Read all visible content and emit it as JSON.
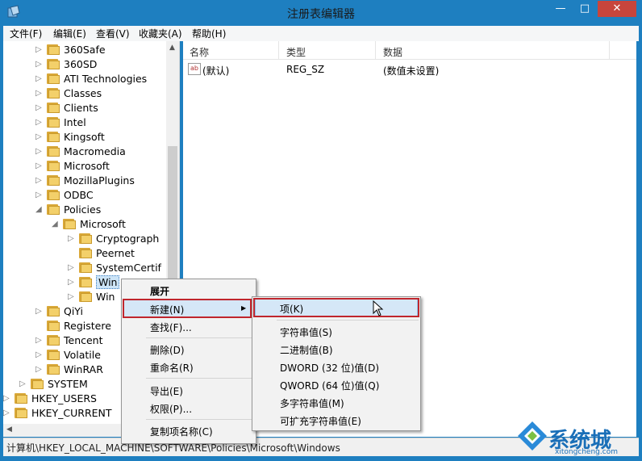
{
  "window": {
    "title": "注册表编辑器",
    "min_glyph": "—",
    "max_glyph": "□",
    "close_glyph": "✕"
  },
  "menubar": [
    "文件(F)",
    "编辑(E)",
    "查看(V)",
    "收藏夹(A)",
    "帮助(H)"
  ],
  "tree": [
    {
      "label": "360Safe",
      "level": 3,
      "expander": "▷"
    },
    {
      "label": "360SD",
      "level": 3,
      "expander": "▷"
    },
    {
      "label": "ATI Technologies",
      "level": 3,
      "expander": "▷"
    },
    {
      "label": "Classes",
      "level": 3,
      "expander": "▷"
    },
    {
      "label": "Clients",
      "level": 3,
      "expander": "▷"
    },
    {
      "label": "Intel",
      "level": 3,
      "expander": "▷"
    },
    {
      "label": "Kingsoft",
      "level": 3,
      "expander": "▷"
    },
    {
      "label": "Macromedia",
      "level": 3,
      "expander": "▷"
    },
    {
      "label": "Microsoft",
      "level": 3,
      "expander": "▷"
    },
    {
      "label": "MozillaPlugins",
      "level": 3,
      "expander": "▷"
    },
    {
      "label": "ODBC",
      "level": 3,
      "expander": "▷"
    },
    {
      "label": "Policies",
      "level": 3,
      "expander": "◢"
    },
    {
      "label": "Microsoft",
      "level": 4,
      "expander": "◢"
    },
    {
      "label": "Cryptograph",
      "level": 5,
      "expander": "▷"
    },
    {
      "label": "Peernet",
      "level": 5,
      "expander": ""
    },
    {
      "label": "SystemCertif",
      "level": 5,
      "expander": "▷"
    },
    {
      "label": "Win",
      "level": 5,
      "expander": "▷",
      "selected": true
    },
    {
      "label": "Win",
      "level": 5,
      "expander": "▷"
    },
    {
      "label": "QiYi",
      "level": 3,
      "expander": "▷"
    },
    {
      "label": "Registere",
      "level": 3,
      "expander": ""
    },
    {
      "label": "Tencent",
      "level": 3,
      "expander": "▷"
    },
    {
      "label": "Volatile",
      "level": 3,
      "expander": "▷"
    },
    {
      "label": "WinRAR",
      "level": 3,
      "expander": "▷"
    },
    {
      "label": "SYSTEM",
      "level": 2,
      "expander": "▷"
    },
    {
      "label": "HKEY_USERS",
      "level": 1,
      "expander": "▷"
    },
    {
      "label": "HKEY_CURRENT",
      "level": 1,
      "expander": "▷"
    }
  ],
  "list": {
    "columns": [
      "名称",
      "类型",
      "数据"
    ],
    "rows": [
      {
        "icon": "ab",
        "name": "(默认)",
        "type": "REG_SZ",
        "data": "(数值未设置)"
      }
    ]
  },
  "context_menu": [
    {
      "label": "展开",
      "bold": true
    },
    {
      "label": "新建(N)",
      "submenu": true,
      "arrow": "▶"
    },
    {
      "label": "查找(F)..."
    },
    {
      "label": "删除(D)"
    },
    {
      "label": "重命名(R)"
    },
    {
      "label": "导出(E)"
    },
    {
      "label": "权限(P)..."
    },
    {
      "label": "复制项名称(C)"
    }
  ],
  "submenu": [
    {
      "label": "项(K)"
    },
    {
      "label": "字符串值(S)"
    },
    {
      "label": "二进制值(B)"
    },
    {
      "label": "DWORD (32 位)值(D)"
    },
    {
      "label": "QWORD (64 位)值(Q)"
    },
    {
      "label": "多字符串值(M)"
    },
    {
      "label": "可扩充字符串值(E)"
    }
  ],
  "statusbar": "计算机\\HKEY_LOCAL_MACHINE\\SOFTWARE\\Policies\\Microsoft\\Windows",
  "watermark": {
    "brand": "系统城",
    "url": "xitongcheng.com"
  },
  "colors": {
    "titlebar": "#1e7fc0",
    "close": "#c7453c",
    "highlight_red": "#c0262d",
    "folder": "#f3d06a"
  }
}
